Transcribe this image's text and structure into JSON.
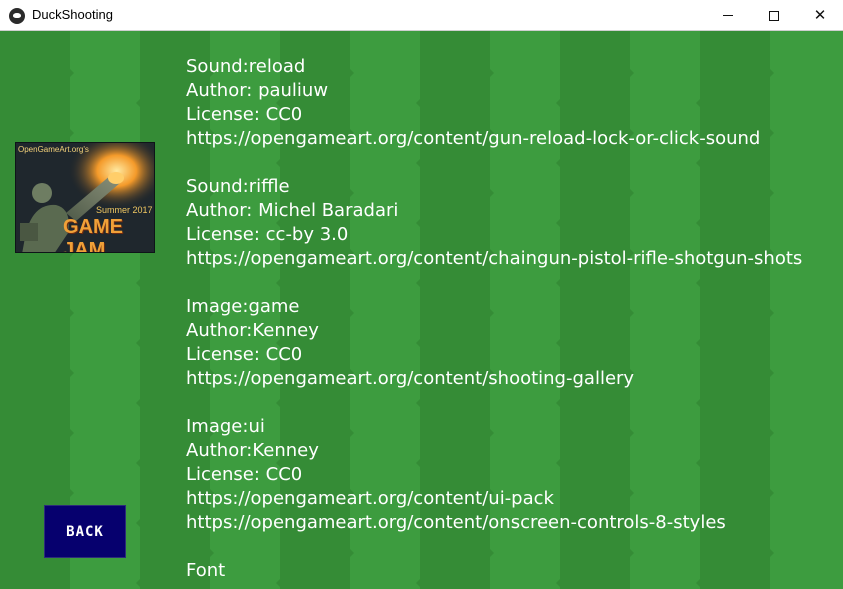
{
  "window": {
    "title": "DuckShooting",
    "minimize_icon": "minimize-icon",
    "maximize_icon": "maximize-icon",
    "close_icon": "close-icon"
  },
  "badge": {
    "top_text": "OpenGameArt.org's",
    "year_text": "Summer 2017",
    "title_text": "GAME JAM"
  },
  "credits": [
    {
      "lines": [
        "Sound:reload",
        "Author: pauliuw",
        "License: CC0",
        "https://opengameart.org/content/gun-reload-lock-or-click-sound"
      ]
    },
    {
      "lines": [
        "Sound:riffle",
        "Author: Michel Baradari",
        "License: cc-by 3.0",
        "https://opengameart.org/content/chaingun-pistol-rifle-shotgun-shots"
      ]
    },
    {
      "lines": [
        "Image:game",
        "Author:Kenney",
        "License: CC0",
        "https://opengameart.org/content/shooting-gallery"
      ]
    },
    {
      "lines": [
        "Image:ui",
        "Author:Kenney",
        "License: CC0",
        "https://opengameart.org/content/ui-pack",
        "https://opengameart.org/content/onscreen-controls-8-styles"
      ]
    },
    {
      "lines": [
        "Font"
      ]
    }
  ],
  "back_button": {
    "label": "BACK"
  },
  "colors": {
    "grass_light": "#3d9c3f",
    "grass_dark": "#358c36",
    "button_bg": "#06006e",
    "text": "#ffffff"
  }
}
